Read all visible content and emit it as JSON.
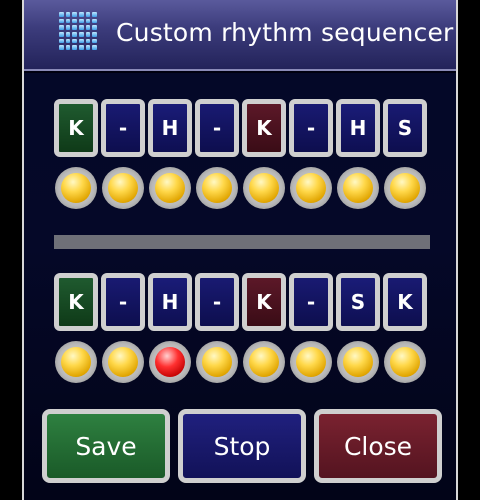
{
  "window": {
    "title": "Custom rhythm sequencer",
    "icon": "grid-icon"
  },
  "pattern1": {
    "steps": [
      "K",
      "-",
      "H",
      "-",
      "K",
      "-",
      "H",
      "S"
    ],
    "leds": [
      "off",
      "off",
      "off",
      "off",
      "off",
      "off",
      "off",
      "off"
    ]
  },
  "pattern2": {
    "steps": [
      "K",
      "-",
      "H",
      "-",
      "K",
      "-",
      "S",
      "K"
    ],
    "leds": [
      "off",
      "off",
      "on",
      "off",
      "off",
      "off",
      "off",
      "off"
    ]
  },
  "buttons": {
    "save": "Save",
    "stop": "Stop",
    "close": "Close"
  },
  "colors": {
    "kick_cell": "#1f5a2f",
    "accent_cell": "#5c1828",
    "default_cell": "#191a72",
    "led_idle": "#ffd84a",
    "led_active": "#ff3030",
    "save_button": "#2e8040",
    "stop_button": "#20207e",
    "close_button": "#7a2230"
  }
}
